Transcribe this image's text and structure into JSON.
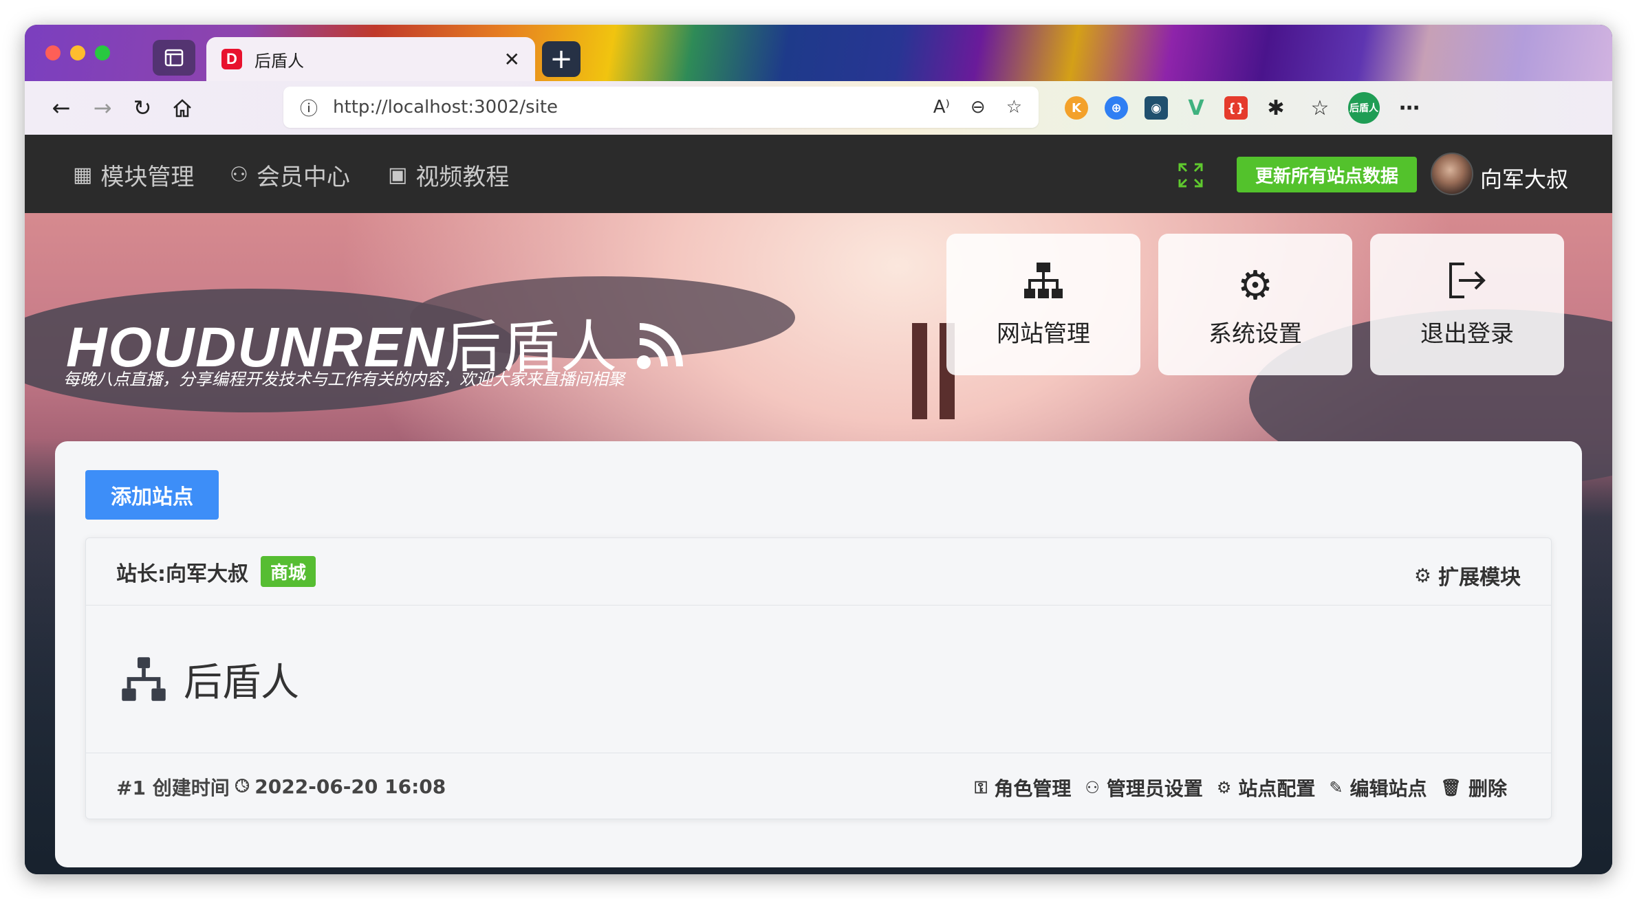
{
  "browser": {
    "tab_title": "后盾人",
    "tab_favicon": "D",
    "tab_close": "✕",
    "new_tab": "+",
    "url": "http://localhost:3002/site",
    "profile_label": "后盾人"
  },
  "nav": {
    "menu": [
      {
        "icon": "grid-icon",
        "label": "模块管理"
      },
      {
        "icon": "user-icon",
        "label": "会员中心"
      },
      {
        "icon": "video-icon",
        "label": "视频教程"
      }
    ],
    "update_button": "更新所有站点数据",
    "username": "向军大叔"
  },
  "hero": {
    "logo_en": "HOUDUNREN",
    "logo_cn": "后盾人",
    "slogan": "每晚八点直播，分享编程开发技术与工作有关的内容，欢迎大家来直播间相聚",
    "quick_links": [
      {
        "icon": "sitemap-icon",
        "label": "网站管理"
      },
      {
        "icon": "gear-icon",
        "label": "系统设置"
      },
      {
        "icon": "logout-icon",
        "label": "退出登录"
      }
    ]
  },
  "main": {
    "add_button": "添加站点",
    "site": {
      "owner": "站长:向军大叔",
      "tag": "商城",
      "extend_label": "扩展模块",
      "name": "后盾人",
      "id_label": "#1 创建时间",
      "created": "2022-06-20 16:08",
      "actions": [
        "角色管理",
        "管理员设置",
        "站点配置",
        "编辑站点",
        "删除"
      ]
    }
  },
  "colors": {
    "accent_green": "#53c22c",
    "accent_blue": "#3d8ef8",
    "appbar": "#2b2b2b"
  }
}
